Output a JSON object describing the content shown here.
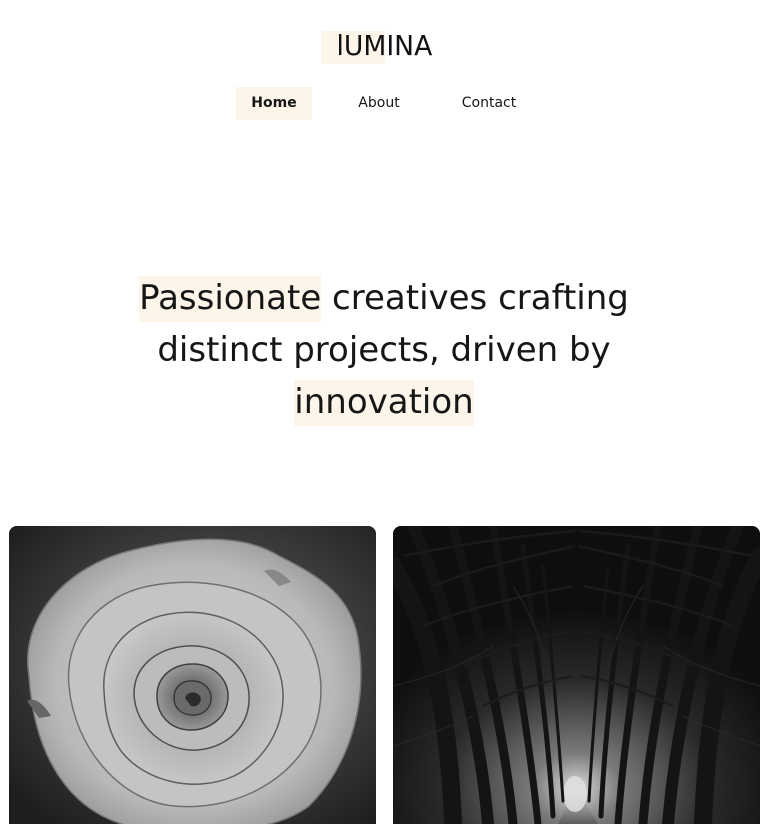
{
  "brand": {
    "logo_text": "lUMINA"
  },
  "nav": {
    "items": [
      {
        "label": "Home",
        "active": true
      },
      {
        "label": "About",
        "active": false
      },
      {
        "label": "Contact",
        "active": false
      }
    ]
  },
  "hero": {
    "line1_highlight": "Passionate",
    "line1_rest": " creatives crafting",
    "line2": "distinct projects, driven by",
    "line3_highlight": "innovation"
  },
  "colors": {
    "highlight": "#fdf5e9",
    "text": "#161616",
    "background": "#ffffff"
  },
  "gallery": {
    "images": [
      {
        "subject": "rose-photo"
      },
      {
        "subject": "tree-tunnel-photo"
      }
    ]
  }
}
